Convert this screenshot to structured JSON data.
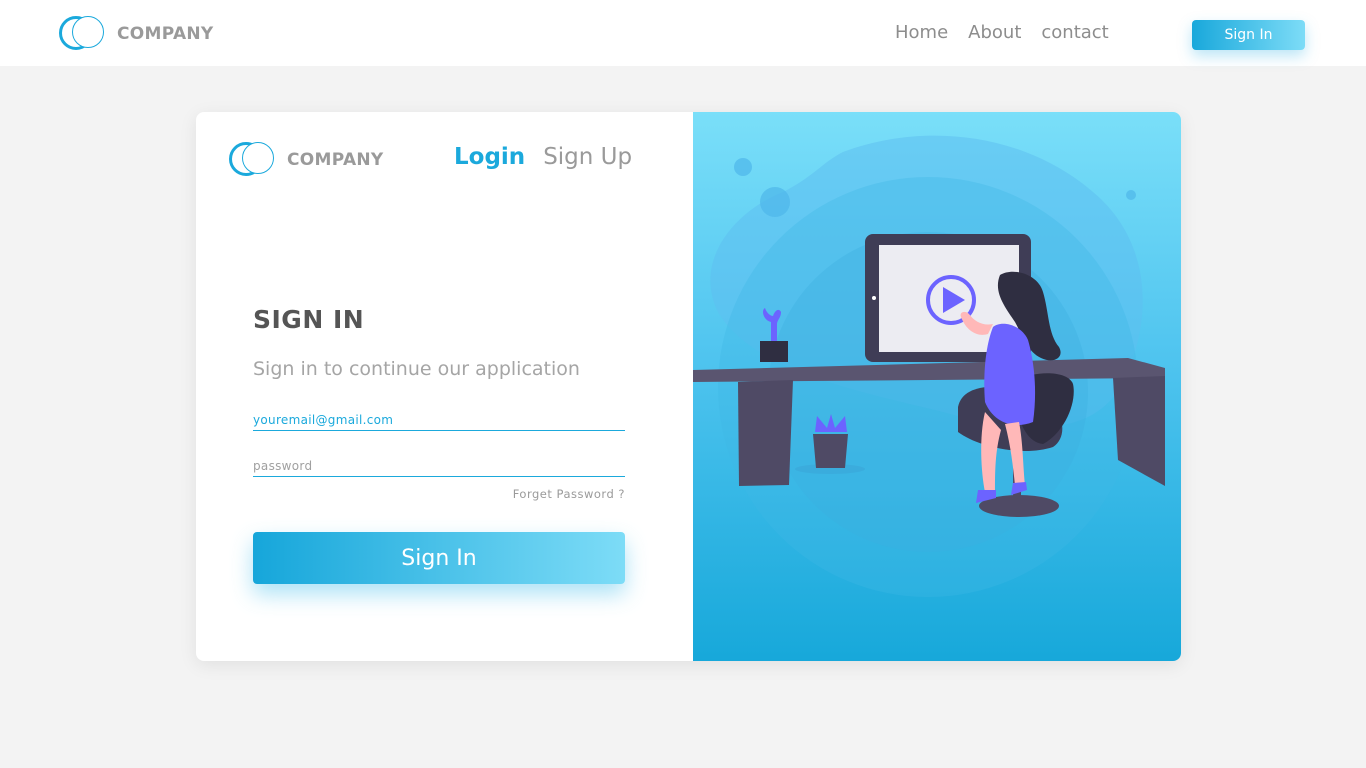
{
  "colors": {
    "accent": "#1ba9dc",
    "accent_light": "#7ddcf7",
    "background": "#f3f3f3",
    "text_muted": "#9a9a9a",
    "desk": "#4f4a65",
    "figure_purple": "#6c63ff"
  },
  "header": {
    "logo_text": "COMPANY",
    "nav": [
      "Home",
      "About",
      "contact"
    ],
    "signin_label": "Sign In"
  },
  "card": {
    "logo_text": "COMPANY",
    "tabs": {
      "login": "Login",
      "signup": "Sign Up"
    },
    "title": "SIGN IN",
    "subtitle": "Sign in to continue our application",
    "email_value": "youremail@gmail.com",
    "password_placeholder": "password",
    "forgot_label": "Forget Password ?",
    "signin_label": "Sign In"
  },
  "illustration": {
    "icons": [
      "monitor-icon",
      "play-icon",
      "plant-icon",
      "desk",
      "chair",
      "woman-figure"
    ]
  }
}
